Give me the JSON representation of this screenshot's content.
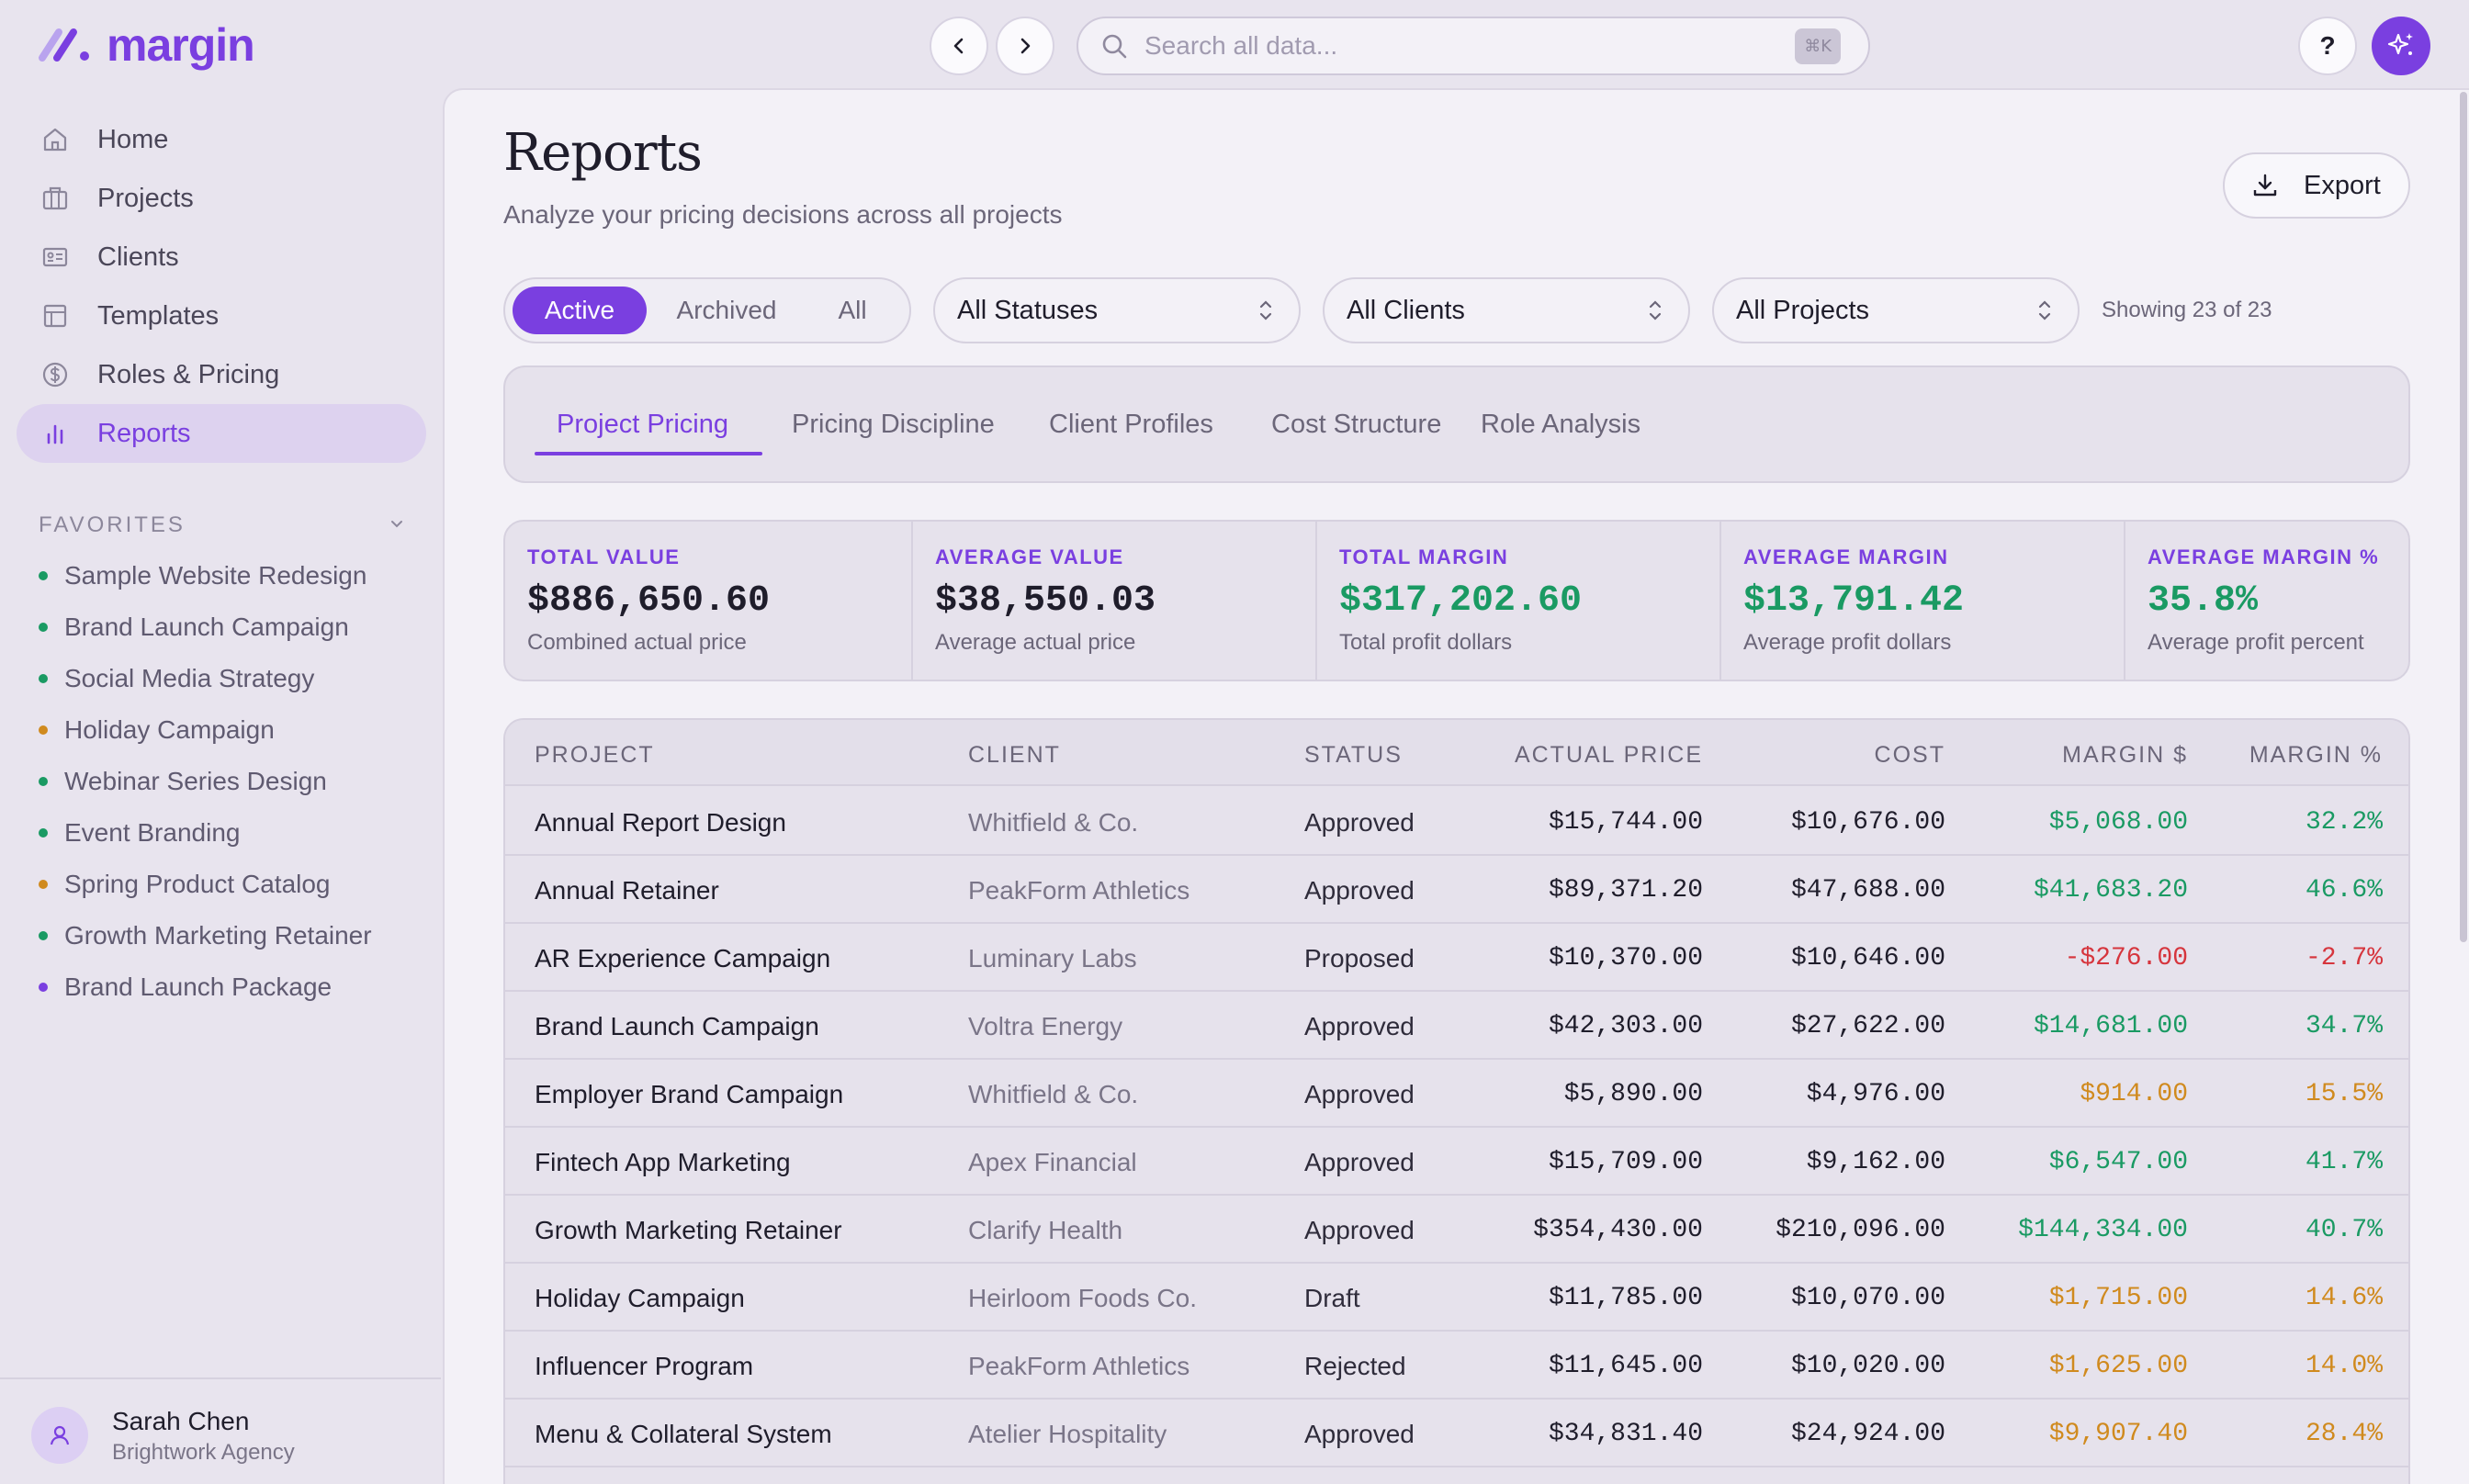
{
  "app": {
    "logo_text": "margin"
  },
  "search": {
    "placeholder": "Search all data...",
    "shortcut": "⌘K"
  },
  "help": {
    "label": "?"
  },
  "sidebar": {
    "items": [
      {
        "label": "Home",
        "icon": "home-icon"
      },
      {
        "label": "Projects",
        "icon": "briefcase-icon"
      },
      {
        "label": "Clients",
        "icon": "id-card-icon"
      },
      {
        "label": "Templates",
        "icon": "template-icon"
      },
      {
        "label": "Roles & Pricing",
        "icon": "dollar-circle-icon"
      },
      {
        "label": "Reports",
        "icon": "bar-chart-icon",
        "active": true
      }
    ],
    "favorites_title": "FAVORITES",
    "favorites": [
      {
        "label": "Sample Website Redesign",
        "color": "#1a9a63"
      },
      {
        "label": "Brand Launch Campaign",
        "color": "#1a9a63"
      },
      {
        "label": "Social Media Strategy",
        "color": "#1a9a63"
      },
      {
        "label": "Holiday Campaign",
        "color": "#d08a1e"
      },
      {
        "label": "Webinar Series Design",
        "color": "#1a9a63"
      },
      {
        "label": "Event Branding",
        "color": "#1a9a63"
      },
      {
        "label": "Spring Product Catalog",
        "color": "#d08a1e"
      },
      {
        "label": "Growth Marketing Retainer",
        "color": "#1a9a63"
      },
      {
        "label": "Brand Launch Package",
        "color": "#7a3fe0"
      }
    ],
    "user": {
      "name": "Sarah Chen",
      "org": "Brightwork Agency"
    }
  },
  "page": {
    "title": "Reports",
    "subtitle": "Analyze your pricing decisions across all projects",
    "export_label": "Export"
  },
  "filters": {
    "segments": [
      "Active",
      "Archived",
      "All"
    ],
    "active_segment": "Active",
    "status_select": "All Statuses",
    "client_select": "All Clients",
    "project_select": "All Projects",
    "showing": "Showing 23 of 23"
  },
  "tabs": [
    "Project Pricing",
    "Pricing Discipline",
    "Client Profiles",
    "Cost Structure",
    "Role Analysis"
  ],
  "active_tab": "Project Pricing",
  "stats": [
    {
      "label": "TOTAL VALUE",
      "value": "$886,650.60",
      "sub": "Combined actual price",
      "tone": "neutral"
    },
    {
      "label": "AVERAGE VALUE",
      "value": "$38,550.03",
      "sub": "Average actual price",
      "tone": "neutral"
    },
    {
      "label": "TOTAL MARGIN",
      "value": "$317,202.60",
      "sub": "Total profit dollars",
      "tone": "positive"
    },
    {
      "label": "AVERAGE MARGIN",
      "value": "$13,791.42",
      "sub": "Average profit dollars",
      "tone": "positive"
    },
    {
      "label": "AVERAGE MARGIN %",
      "value": "35.8%",
      "sub": "Average profit percent",
      "tone": "positive"
    }
  ],
  "table": {
    "headers": [
      "PROJECT",
      "CLIENT",
      "STATUS",
      "ACTUAL PRICE",
      "COST",
      "MARGIN $",
      "MARGIN %"
    ],
    "rows": [
      {
        "project": "Annual Report Design",
        "client": "Whitfield & Co.",
        "status": "Approved",
        "price": "$15,744.00",
        "cost": "$10,676.00",
        "margin": "$5,068.00",
        "pct": "32.2%",
        "tone": "good"
      },
      {
        "project": "Annual Retainer",
        "client": "PeakForm Athletics",
        "status": "Approved",
        "price": "$89,371.20",
        "cost": "$47,688.00",
        "margin": "$41,683.20",
        "pct": "46.6%",
        "tone": "good"
      },
      {
        "project": "AR Experience Campaign",
        "client": "Luminary Labs",
        "status": "Proposed",
        "price": "$10,370.00",
        "cost": "$10,646.00",
        "margin": "-$276.00",
        "pct": "-2.7%",
        "tone": "bad"
      },
      {
        "project": "Brand Launch Campaign",
        "client": "Voltra Energy",
        "status": "Approved",
        "price": "$42,303.00",
        "cost": "$27,622.00",
        "margin": "$14,681.00",
        "pct": "34.7%",
        "tone": "good"
      },
      {
        "project": "Employer Brand Campaign",
        "client": "Whitfield & Co.",
        "status": "Approved",
        "price": "$5,890.00",
        "cost": "$4,976.00",
        "margin": "$914.00",
        "pct": "15.5%",
        "tone": "warn"
      },
      {
        "project": "Fintech App Marketing",
        "client": "Apex Financial",
        "status": "Approved",
        "price": "$15,709.00",
        "cost": "$9,162.00",
        "margin": "$6,547.00",
        "pct": "41.7%",
        "tone": "good"
      },
      {
        "project": "Growth Marketing Retainer",
        "client": "Clarify Health",
        "status": "Approved",
        "price": "$354,430.00",
        "cost": "$210,096.00",
        "margin": "$144,334.00",
        "pct": "40.7%",
        "tone": "good"
      },
      {
        "project": "Holiday Campaign",
        "client": "Heirloom Foods Co.",
        "status": "Draft",
        "price": "$11,785.00",
        "cost": "$10,070.00",
        "margin": "$1,715.00",
        "pct": "14.6%",
        "tone": "warn"
      },
      {
        "project": "Influencer Program",
        "client": "PeakForm Athletics",
        "status": "Rejected",
        "price": "$11,645.00",
        "cost": "$10,020.00",
        "margin": "$1,625.00",
        "pct": "14.0%",
        "tone": "warn"
      },
      {
        "project": "Menu & Collateral System",
        "client": "Atelier Hospitality",
        "status": "Approved",
        "price": "$34,831.40",
        "cost": "$24,924.00",
        "margin": "$9,907.40",
        "pct": "28.4%",
        "tone": "warn"
      }
    ]
  },
  "colors": {
    "accent": "#7a3fe0",
    "positive": "#1a9a63",
    "negative": "#d6353d",
    "warning": "#d08a1e"
  }
}
